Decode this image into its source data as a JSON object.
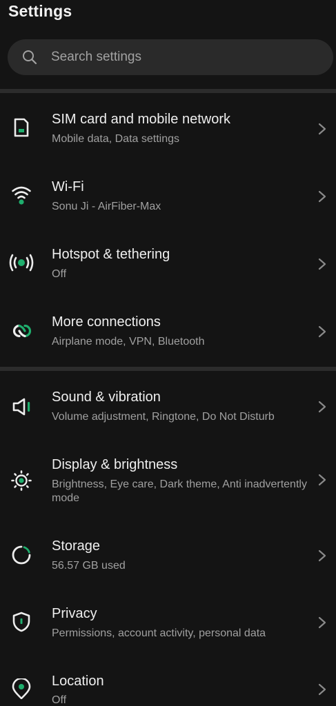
{
  "header": {
    "title": "Settings"
  },
  "search": {
    "placeholder": "Search settings",
    "icon": "search-icon"
  },
  "colors": {
    "accent": "#1fae6d",
    "background": "#141414",
    "divider": "#2c2c2c"
  },
  "items": [
    {
      "id": "sim",
      "title": "SIM card and mobile network",
      "subtitle": "Mobile data, Data settings",
      "icon": "sim-card-icon"
    },
    {
      "id": "wifi",
      "title": "Wi-Fi",
      "subtitle": "Sonu Ji - AirFiber-Max",
      "icon": "wifi-icon"
    },
    {
      "id": "hotspot",
      "title": "Hotspot & tethering",
      "subtitle": "Off",
      "icon": "hotspot-icon"
    },
    {
      "id": "connections",
      "title": "More connections",
      "subtitle": "Airplane mode, VPN, Bluetooth",
      "icon": "link-icon"
    },
    {
      "id": "sound",
      "title": "Sound & vibration",
      "subtitle": "Volume adjustment, Ringtone, Do Not Disturb",
      "icon": "speaker-icon"
    },
    {
      "id": "display",
      "title": "Display & brightness",
      "subtitle": "Brightness, Eye care, Dark theme, Anti inadvertently mode",
      "icon": "brightness-icon"
    },
    {
      "id": "storage",
      "title": "Storage",
      "subtitle": "56.57 GB used",
      "icon": "storage-icon"
    },
    {
      "id": "privacy",
      "title": "Privacy",
      "subtitle": "Permissions, account activity, personal data",
      "icon": "shield-icon"
    },
    {
      "id": "location",
      "title": "Location",
      "subtitle": "Off",
      "icon": "location-pin-icon"
    }
  ]
}
